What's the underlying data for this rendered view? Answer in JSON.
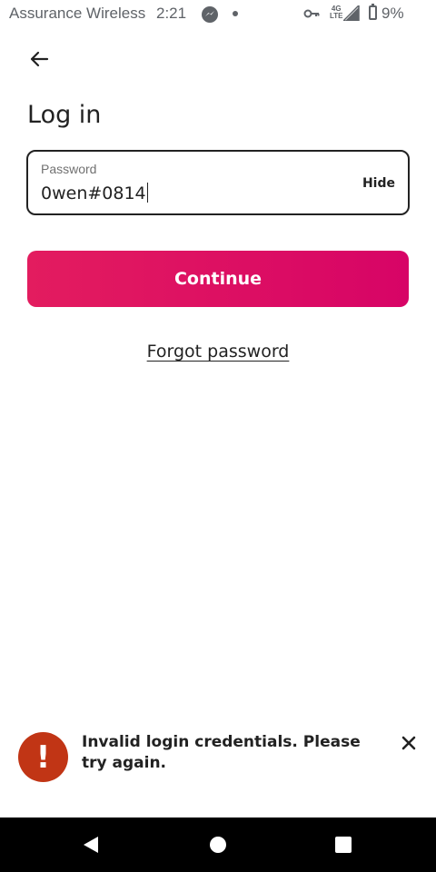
{
  "status_bar": {
    "carrier": "Assurance Wireless",
    "time": "2:21",
    "network_top": "4G",
    "network_bottom": "LTE",
    "battery": "9%"
  },
  "icons": {
    "back": "arrow-left-icon",
    "messenger": "messenger-icon",
    "vpn": "key-icon",
    "signal": "signal-icon",
    "battery": "battery-icon",
    "error": "exclamation-icon",
    "close": "close-icon"
  },
  "page": {
    "title": "Log in"
  },
  "password_field": {
    "label": "Password",
    "value": "0wen#0814",
    "toggle_label": "Hide"
  },
  "actions": {
    "continue_label": "Continue",
    "forgot_label": "Forgot password"
  },
  "toast": {
    "icon_glyph": "!",
    "message": "Invalid login credentials. Please try again."
  },
  "colors": {
    "brand": "#e31c5f",
    "error": "#c13515"
  }
}
